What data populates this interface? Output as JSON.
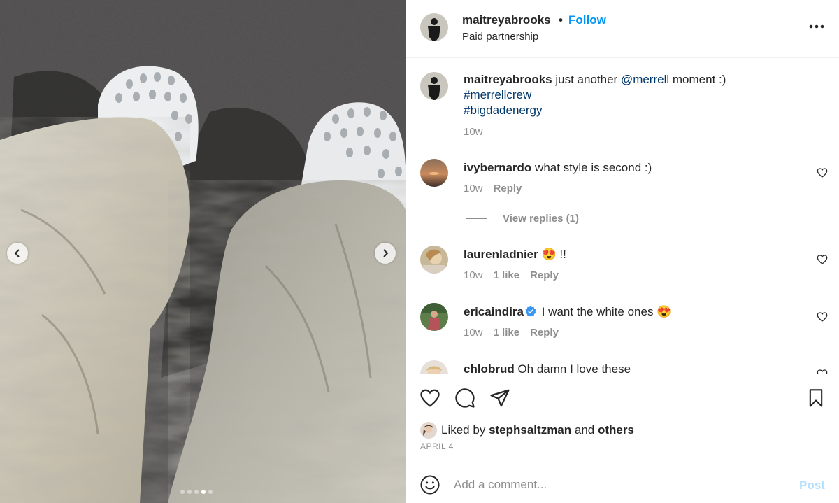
{
  "post": {
    "author": "maitreyabrooks",
    "separator": "•",
    "follow_label": "Follow",
    "subtitle": "Paid partnership",
    "carousel": {
      "total": 5,
      "active_index": 3
    }
  },
  "caption": {
    "author": "maitreyabrooks",
    "text_pre": "just another",
    "mention": "@merrell",
    "text_post": "moment :)",
    "hashtag1": "#merrellcrew",
    "hashtag2": "#bigdadenergy",
    "time": "10w"
  },
  "comments": [
    {
      "user": "ivybernardo",
      "text": "what style is second :)",
      "time": "10w",
      "likes": "",
      "reply": "Reply",
      "view_replies": "View replies (1)"
    },
    {
      "user": "laurenladnier",
      "text": "😍 !!",
      "time": "10w",
      "likes": "1 like",
      "reply": "Reply"
    },
    {
      "user": "ericaindira",
      "text": "I want the white ones 😍",
      "time": "10w",
      "likes": "1 like",
      "reply": "Reply",
      "verified": true
    },
    {
      "user": "chlobrud",
      "text": "Oh damn I love these"
    }
  ],
  "likes": {
    "prefix": "Liked by",
    "user": "stephsaltzman",
    "and": "and",
    "others": "others"
  },
  "date": "APRIL 4",
  "add_comment": {
    "placeholder": "Add a comment...",
    "post_label": "Post"
  },
  "icons": {
    "more": "more-horizontal-icon",
    "like": "heart-icon",
    "comment": "comment-bubble-icon",
    "share": "paper-plane-icon",
    "save": "bookmark-icon",
    "emoji": "smiley-icon",
    "verified": "verified-badge-icon"
  },
  "colors": {
    "link": "#00376b",
    "follow": "#0095f6",
    "muted": "#8e8e8e",
    "post_disabled": "#b2dffc",
    "verified": "#3897f0"
  }
}
